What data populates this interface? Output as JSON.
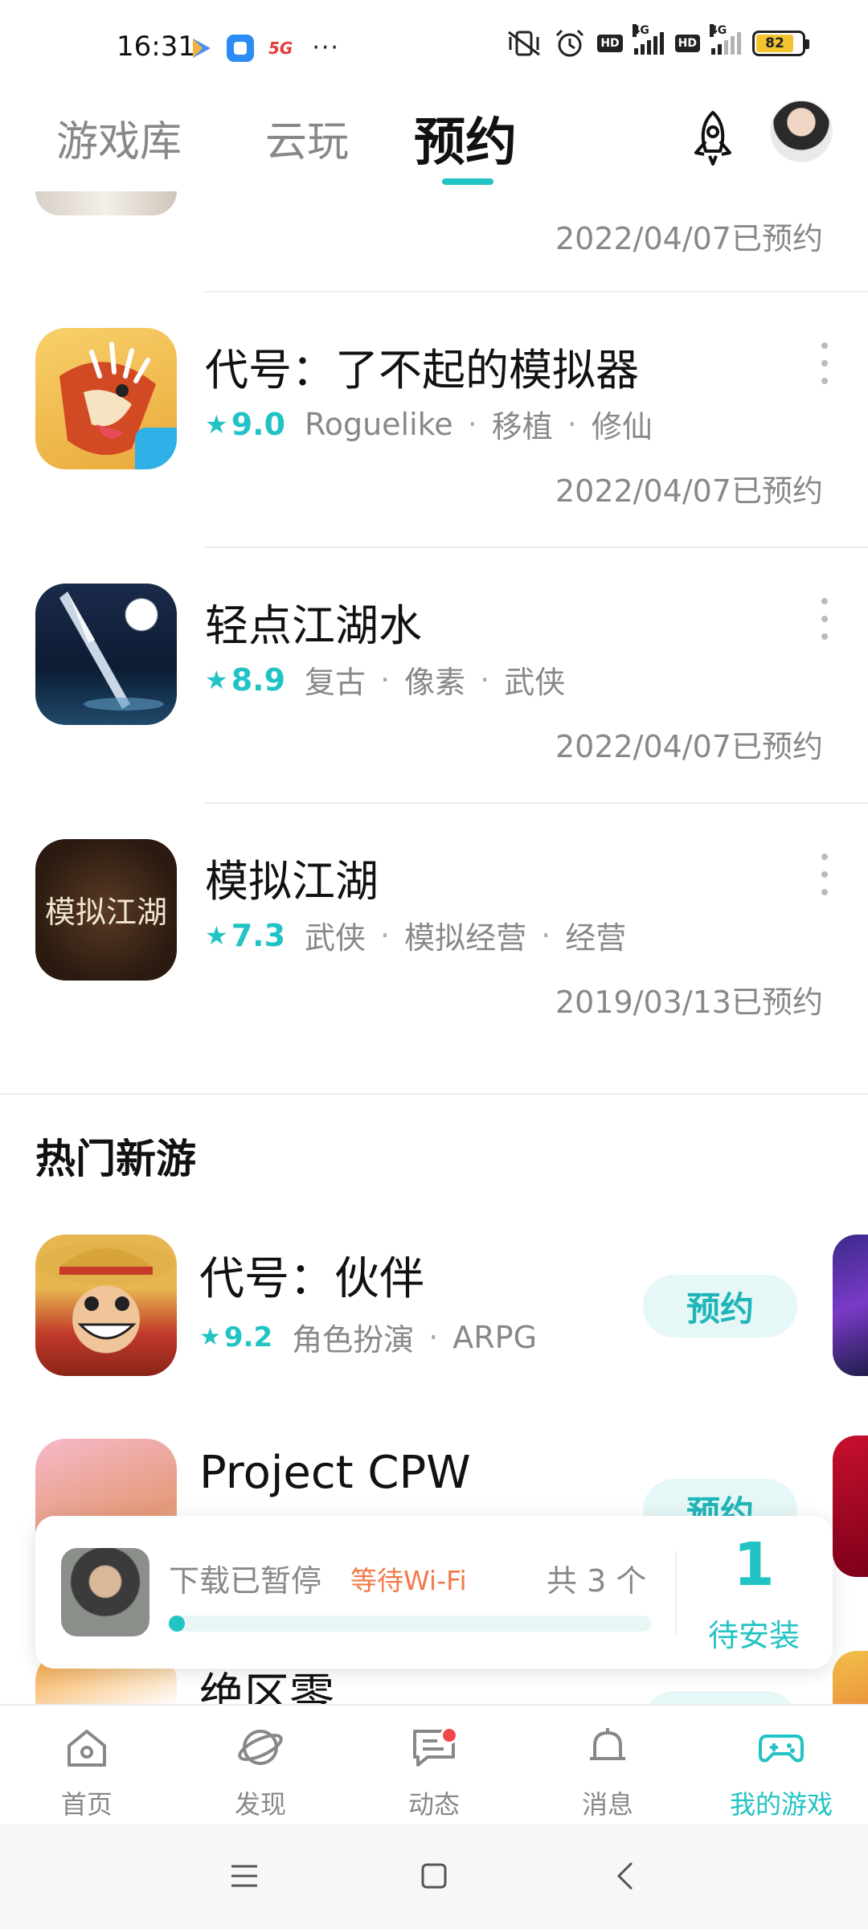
{
  "status_bar": {
    "time": "16:31",
    "network_5g": "5G",
    "more": "···",
    "battery": "82",
    "hd1": "HD",
    "hd2": "HD",
    "sig1": "4G",
    "sig2": "4G"
  },
  "top_tabs": {
    "items": [
      "游戏库",
      "云玩",
      "预约"
    ],
    "active": "预约"
  },
  "first_item_date": "2022/04/07已预约",
  "reserved": [
    {
      "title": "代号：了不起的模拟器",
      "score": "9.0",
      "tags": [
        "Roguelike",
        "移植",
        "修仙"
      ],
      "date": "2022/04/07已预约",
      "icon": "fox-game-icon"
    },
    {
      "title": "轻点江湖水",
      "score": "8.9",
      "tags": [
        "复古",
        "像素",
        "武侠"
      ],
      "date": "2022/04/07已预约",
      "icon": "sword-game-icon"
    },
    {
      "title": "模拟江湖",
      "score": "7.3",
      "tags": [
        "武侠",
        "模拟经营",
        "经营"
      ],
      "date": "2019/03/13已预约",
      "icon": "jianghu-game-icon"
    }
  ],
  "jianghu_icon_text": "模拟江湖",
  "hot_section": {
    "title": "热门新游",
    "games": [
      {
        "title": "代号：伙伴",
        "score": "9.2",
        "tags": [
          "角色扮演",
          "ARPG"
        ],
        "button": "预约"
      },
      {
        "title": "Project CPW",
        "button": "预约"
      },
      {
        "title": "绝区零",
        "button": "预约"
      }
    ]
  },
  "download": {
    "status": "下载已暂停",
    "waiting": "等待Wi-Fi",
    "total": "共 3 个",
    "pending_count": "1",
    "pending_label": "待安装",
    "progress_percent": 0
  },
  "bottom_nav": [
    {
      "label": "首页",
      "icon": "home-icon"
    },
    {
      "label": "发现",
      "icon": "discover-icon"
    },
    {
      "label": "动态",
      "icon": "chat-icon",
      "badge": true
    },
    {
      "label": "消息",
      "icon": "bell-icon"
    },
    {
      "label": "我的游戏",
      "icon": "gamepad-icon",
      "active": true
    }
  ],
  "colors": {
    "accent": "#22c3c5",
    "warning": "#f27a4a",
    "badge": "#f04848"
  }
}
